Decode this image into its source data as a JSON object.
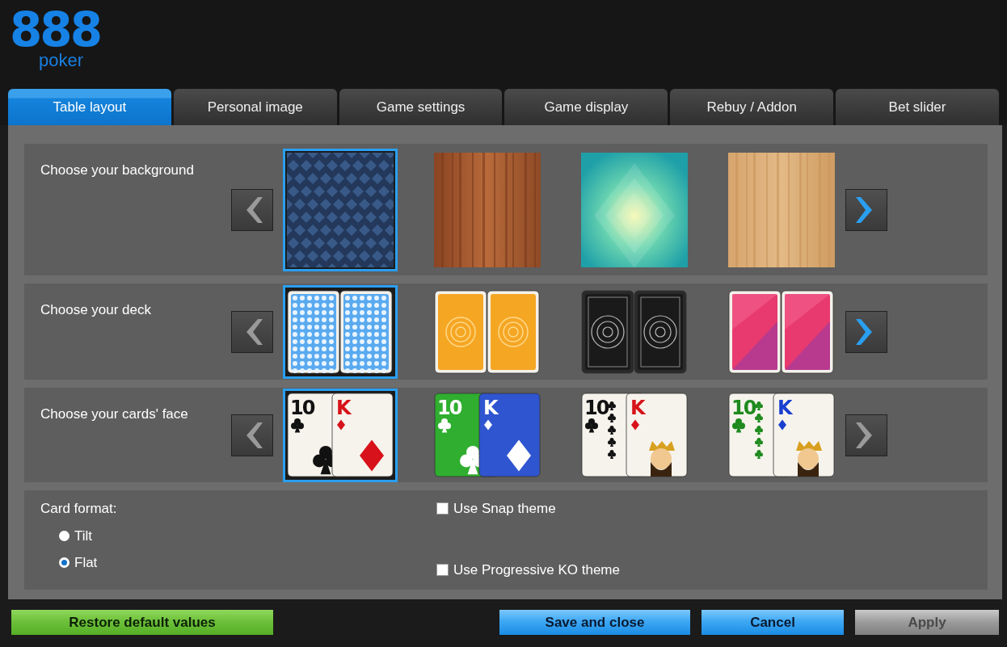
{
  "logo": {
    "digits": "888",
    "word": "poker"
  },
  "tabs": [
    {
      "label": "Table layout",
      "selected": true
    },
    {
      "label": "Personal image",
      "selected": false
    },
    {
      "label": "Game settings",
      "selected": false
    },
    {
      "label": "Game display",
      "selected": false
    },
    {
      "label": "Rebuy / Addon",
      "selected": false
    },
    {
      "label": "Bet slider",
      "selected": false
    }
  ],
  "pickers": [
    {
      "kind": "background",
      "label": "Choose your background",
      "prev": {
        "disabled": true
      },
      "next": {
        "disabled": false
      },
      "options": [
        {
          "kind": "argyle",
          "selected": true
        },
        {
          "kind": "wood-dark",
          "selected": false
        },
        {
          "kind": "prism",
          "selected": false
        },
        {
          "kind": "wood-light",
          "selected": false
        }
      ]
    },
    {
      "kind": "deck",
      "label": "Choose your deck",
      "prev": {
        "disabled": true
      },
      "next": {
        "disabled": false
      },
      "options": [
        {
          "kind": "dots-blue",
          "selected": true
        },
        {
          "kind": "mandala-orange",
          "selected": false
        },
        {
          "kind": "ornate-black",
          "selected": false
        },
        {
          "kind": "geo-pink",
          "selected": false
        }
      ]
    },
    {
      "kind": "face",
      "label": "Choose your cards' face",
      "prev": {
        "disabled": true
      },
      "next": {
        "disabled": true
      },
      "options": [
        {
          "kind": "classic",
          "rank_1": "10",
          "rank_2": "K",
          "selected": true
        },
        {
          "kind": "colored",
          "rank_1": "10",
          "rank_2": "K",
          "selected": false
        },
        {
          "kind": "courtier",
          "rank_1": "10",
          "rank_2": "K",
          "selected": false
        },
        {
          "kind": "courtier-four",
          "rank_1": "10",
          "rank_2": "K",
          "selected": false
        }
      ]
    }
  ],
  "card_format": {
    "label": "Card format:",
    "options": [
      {
        "label": "Tilt",
        "selected": false
      },
      {
        "label": "Flat",
        "selected": true
      }
    ]
  },
  "themes": [
    {
      "label": "Use Snap theme",
      "checked": false
    },
    {
      "label": "Use Progressive KO theme",
      "checked": false
    }
  ],
  "buttons": [
    {
      "kind": "restore",
      "label": "Restore default values",
      "disabled": false
    },
    {
      "kind": "primary",
      "label": "Save and close",
      "disabled": false
    },
    {
      "kind": "primary",
      "label": "Cancel",
      "disabled": false
    },
    {
      "kind": "primary",
      "label": "Apply",
      "disabled": true
    }
  ]
}
